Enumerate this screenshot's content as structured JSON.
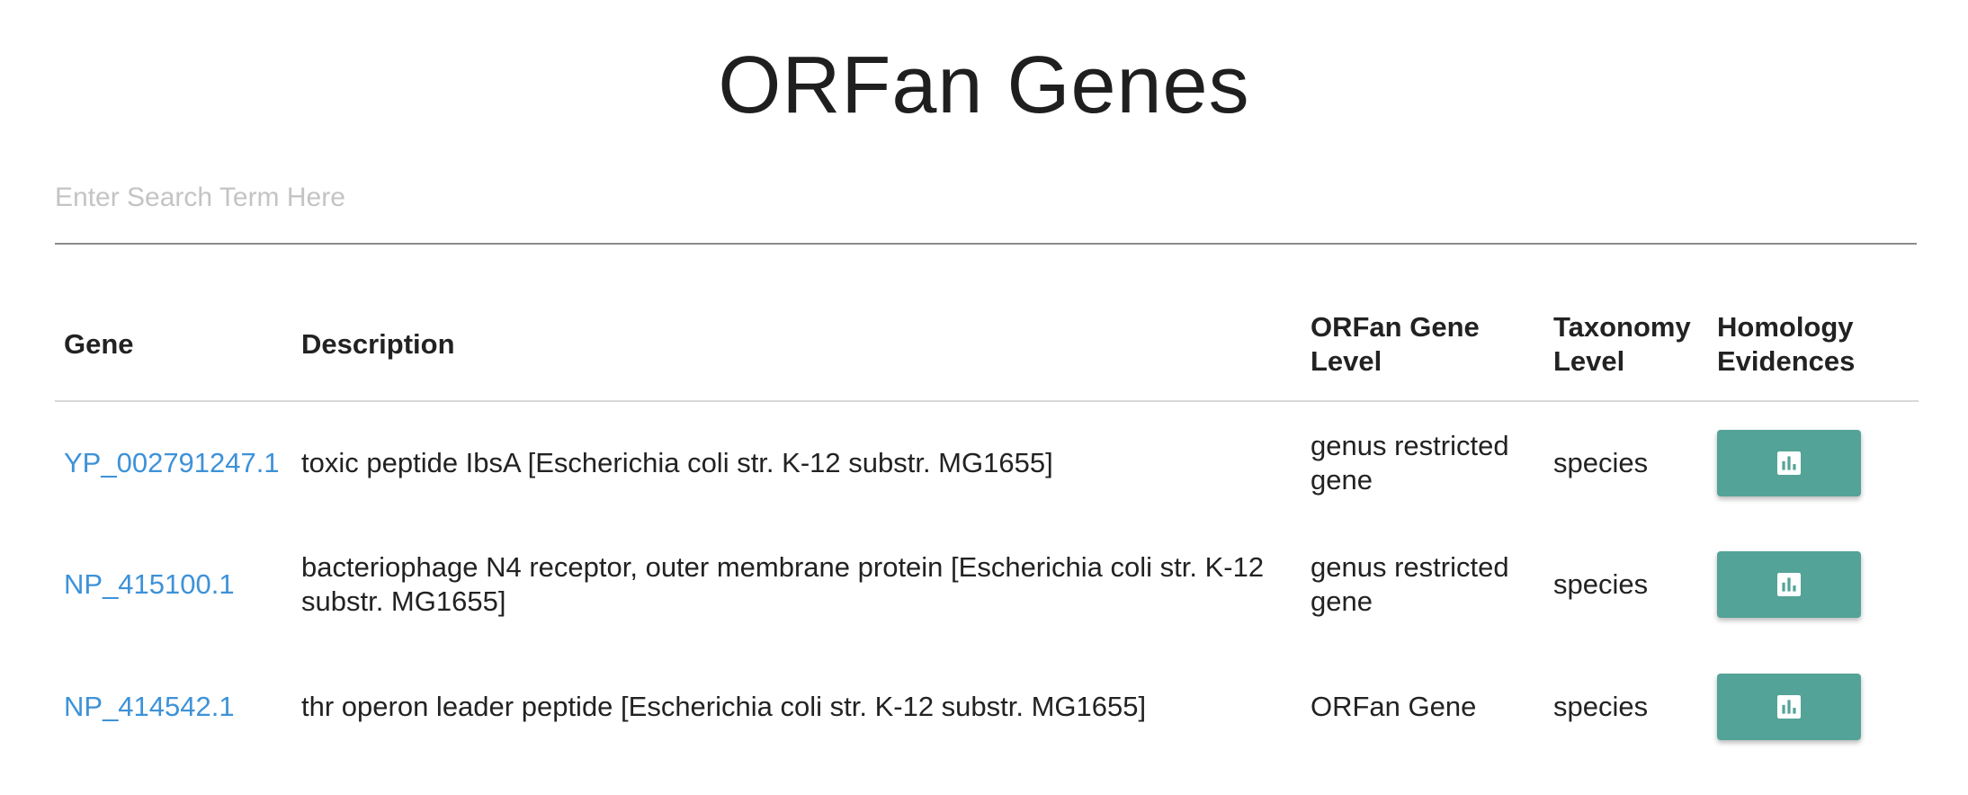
{
  "page": {
    "title": "ORFan Genes"
  },
  "search": {
    "placeholder": "Enter Search Term Here",
    "value": ""
  },
  "table": {
    "headers": {
      "gene": "Gene",
      "description": "Description",
      "orfan_level_line1": "ORFan Gene",
      "orfan_level_line2": "Level",
      "taxonomy_line1": "Taxonomy",
      "taxonomy_line2": "Level",
      "homology_line1": "Homology",
      "homology_line2": "Evidences"
    },
    "rows": [
      {
        "gene": "YP_002791247.1",
        "description": "toxic peptide IbsA [Escherichia coli str. K-12 substr. MG1655]",
        "orfan_level": "genus restricted gene",
        "taxonomy_level": "species",
        "evidence_icon": "bar-chart-icon"
      },
      {
        "gene": "NP_415100.1",
        "description": "bacteriophage N4 receptor, outer membrane protein [Escherichia coli str. K-12 substr. MG1655]",
        "orfan_level": "genus restricted gene",
        "taxonomy_level": "species",
        "evidence_icon": "bar-chart-icon"
      },
      {
        "gene": "NP_414542.1",
        "description": "thr operon leader peptide [Escherichia coli str. K-12 substr. MG1655]",
        "orfan_level": "ORFan Gene",
        "taxonomy_level": "species",
        "evidence_icon": "bar-chart-icon"
      }
    ]
  },
  "colors": {
    "link": "#3d92d8",
    "button": "#54a398",
    "title": "#1f1f1f"
  }
}
